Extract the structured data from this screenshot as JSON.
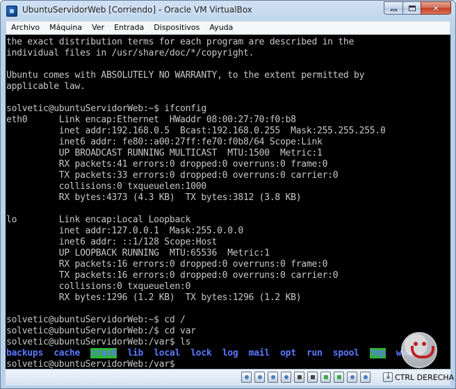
{
  "window": {
    "title": "UbuntuServidorWeb [Corriendo] - Oracle VM VirtualBox"
  },
  "menu": {
    "items": [
      "Archivo",
      "Máquina",
      "Ver",
      "Entrada",
      "Dispositivos",
      "Ayuda"
    ]
  },
  "terminal": {
    "lines": [
      "the exact distribution terms for each program are described in the",
      "individual files in /usr/share/doc/*/copyright.",
      "",
      "Ubuntu comes with ABSOLUTELY NO WARRANTY, to the extent permitted by",
      "applicable law.",
      "",
      "solvetic@ubuntuServidorWeb:~$ ifconfig",
      "eth0      Link encap:Ethernet  HWaddr 08:00:27:70:f0:b8",
      "          inet addr:192.168.0.5  Bcast:192.168.0.255  Mask:255.255.255.0",
      "          inet6 addr: fe80::a00:27ff:fe70:f0b8/64 Scope:Link",
      "          UP BROADCAST RUNNING MULTICAST  MTU:1500  Metric:1",
      "          RX packets:41 errors:0 dropped:0 overruns:0 frame:0",
      "          TX packets:33 errors:0 dropped:0 overruns:0 carrier:0",
      "          collisions:0 txqueuelen:1000",
      "          RX bytes:4373 (4.3 KB)  TX bytes:3812 (3.8 KB)",
      "",
      "lo        Link encap:Local Loopback",
      "          inet addr:127.0.0.1  Mask:255.0.0.0",
      "          inet6 addr: ::1/128 Scope:Host",
      "          UP LOOPBACK RUNNING  MTU:65536  Metric:1",
      "          RX packets:16 errors:0 dropped:0 overruns:0 frame:0",
      "          TX packets:16 errors:0 dropped:0 overruns:0 carrier:0",
      "          collisions:0 txqueuelen:0",
      "          RX bytes:1296 (1.2 KB)  TX bytes:1296 (1.2 KB)",
      "",
      "solvetic@ubuntuServidorWeb:~$ cd /",
      "solvetic@ubuntuServidorWeb:/$ cd var",
      "solvetic@ubuntuServidorWeb:/var$ ls"
    ],
    "ls_entries": [
      {
        "name": "backups",
        "highlight": false
      },
      {
        "name": "cache",
        "highlight": false
      },
      {
        "name": "crash",
        "highlight": true
      },
      {
        "name": "lib",
        "highlight": false
      },
      {
        "name": "local",
        "highlight": false
      },
      {
        "name": "lock",
        "highlight": false
      },
      {
        "name": "log",
        "highlight": false
      },
      {
        "name": "mail",
        "highlight": false
      },
      {
        "name": "opt",
        "highlight": false
      },
      {
        "name": "run",
        "highlight": false
      },
      {
        "name": "spool",
        "highlight": false
      },
      {
        "name": "tmp",
        "highlight": true
      },
      {
        "name": "www",
        "highlight": false
      }
    ],
    "final_prompt": "solvetic@ubuntuServidorWeb:/var$",
    "colors": {
      "background": "#000000",
      "text": "#c8c8c8",
      "directory": "#5b78ff",
      "highlight_bg": "#2fb336"
    }
  },
  "statusbar": {
    "icons": [
      "hard-disk-icon",
      "optical-drive-icon",
      "usb-icon",
      "shared-folders-icon",
      "display-icon",
      "video-capture-icon",
      "network-icon",
      "usb-device-icon",
      "audio-icon",
      "mouse-integration-icon"
    ],
    "host_key": "CTRL DERECHA"
  }
}
